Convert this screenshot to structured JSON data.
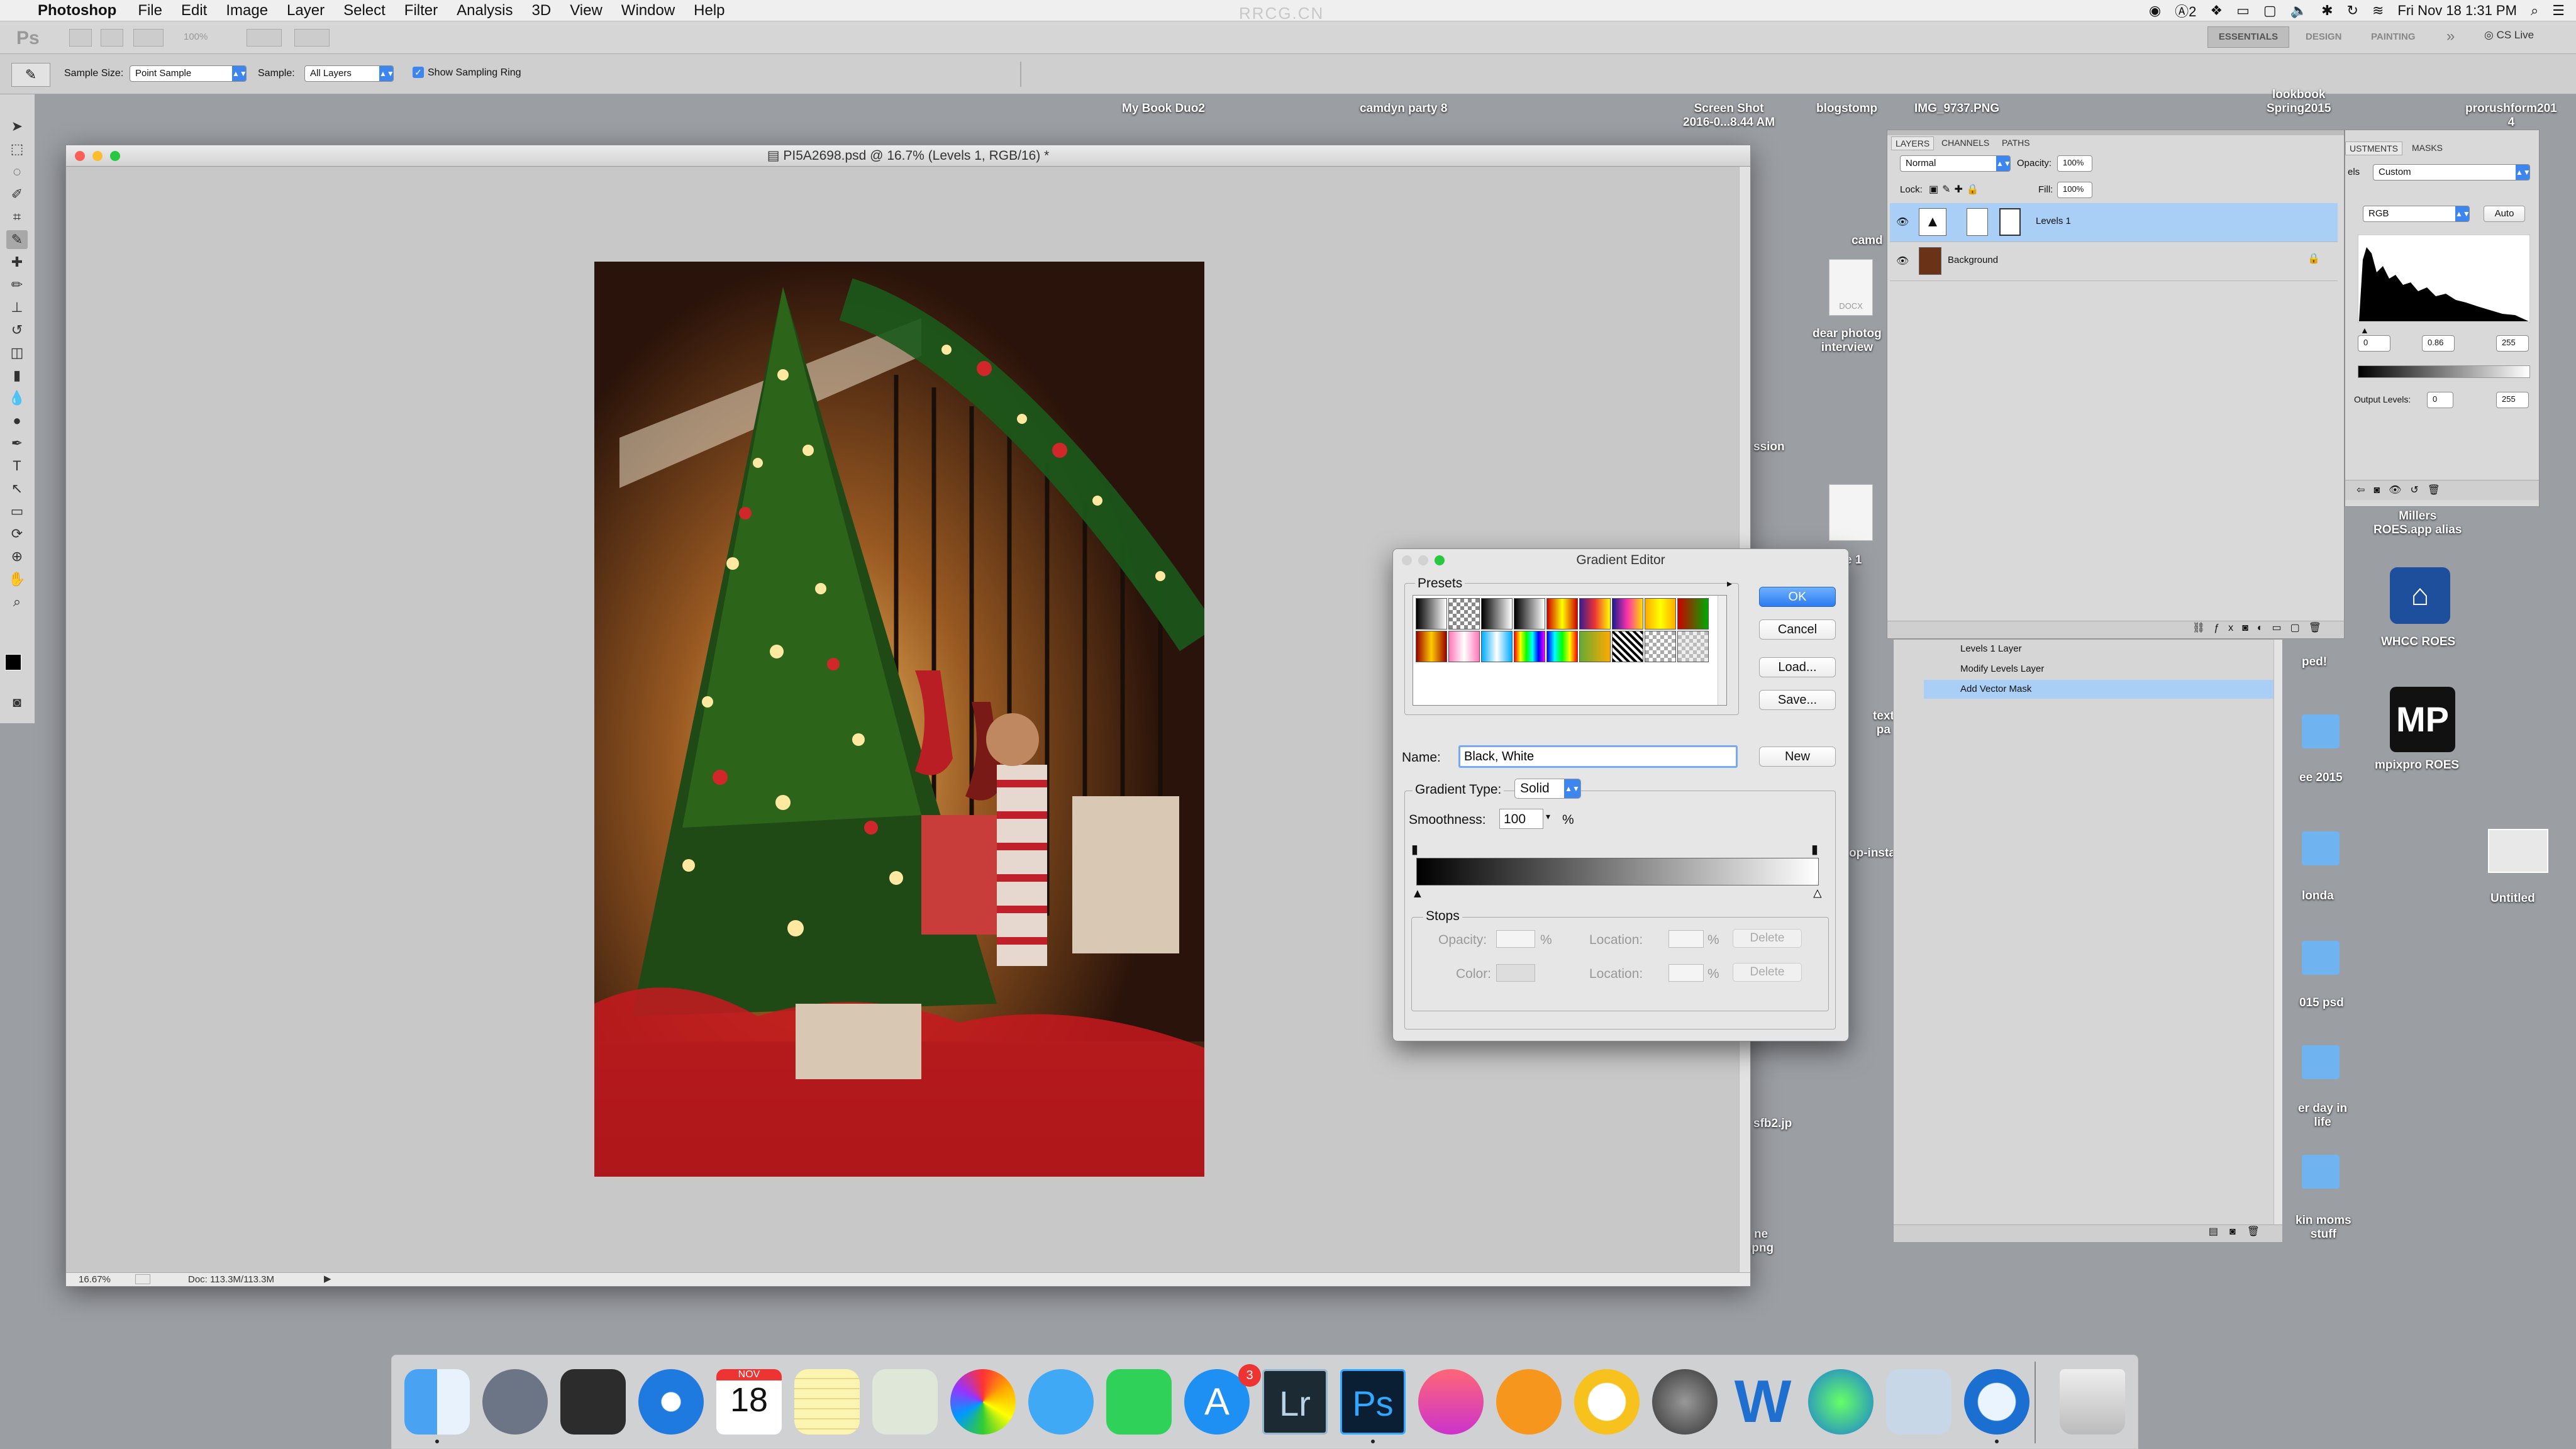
{
  "menubar": {
    "app_name": "Photoshop",
    "menus": [
      "File",
      "Edit",
      "Image",
      "Layer",
      "Select",
      "Filter",
      "Analysis",
      "3D",
      "View",
      "Window",
      "Help"
    ],
    "watermark": "RRCG.CN",
    "status_2": "2",
    "clock": "Fri Nov 18  1:31 PM"
  },
  "appbar": {
    "workspaces": [
      "ESSENTIALS",
      "DESIGN",
      "PAINTING"
    ],
    "more": "»",
    "cs_live": "CS Live",
    "zoom": "100%"
  },
  "options": {
    "sample_size_label": "Sample Size:",
    "sample_size_value": "Point Sample",
    "sample_label": "Sample:",
    "sample_value": "All Layers",
    "ring_label": "Show Sampling Ring"
  },
  "desktop": {
    "labels": {
      "mybook": "My Book Duo2",
      "camdyn": "camdyn party 8",
      "screenshot": "Screen Shot\n2016-0...8.44 AM",
      "blogstomp": "blogstomp",
      "img": "IMG_9737.PNG",
      "lookbook": "lookbook\nSpring2015",
      "proru": "prorushform201\n4",
      "camd": "camd",
      "dear": "dear photog\ninterview",
      "ssion": "ssion",
      "e1": "e 1",
      "millers": "Millers\nROES.app alias",
      "whcc": "WHCC ROES",
      "mpix": "mpixpro ROES",
      "untitled": "Untitled",
      "ped": "ped!",
      "text": "text\npa",
      "ee2015": "ee 2015",
      "opinsta": "op-insta",
      "londa": "londa",
      "psd15": "015 psd",
      "eday": "er day in\nlife",
      "sfb2": "sfb2.jp",
      "moms": "kin moms\nstuff",
      "ne": "ne\n.png",
      "docx": "DOCX"
    }
  },
  "document": {
    "title": "PI5A2698.psd @ 16.7% (Levels 1, RGB/16) *",
    "zoom": "16.67%",
    "doc_size": "Doc: 113.3M/113.3M"
  },
  "layers_panel": {
    "tabs": [
      "LAYERS",
      "CHANNELS",
      "PATHS"
    ],
    "blend_mode": "Normal",
    "opacity_label": "Opacity:",
    "opacity_value": "100%",
    "lock_label": "Lock:",
    "fill_label": "Fill:",
    "fill_value": "100%",
    "layers": [
      {
        "name": "Levels 1",
        "selected": true
      },
      {
        "name": "Background",
        "selected": false
      }
    ]
  },
  "history_panel": {
    "items": [
      {
        "label": "Levels 1 Layer",
        "selected": false
      },
      {
        "label": "Modify Levels Layer",
        "selected": false
      },
      {
        "label": "Add Vector Mask",
        "selected": true
      }
    ]
  },
  "adjustments_panel": {
    "tabs": [
      "USTMENTS",
      "MASKS"
    ],
    "tab_prefix": "els",
    "preset": "Custom",
    "channel": "RGB",
    "auto_label": "Auto",
    "input_values": [
      "0",
      "0.86",
      "255"
    ],
    "output_label": "Output Levels:",
    "output_values": [
      "0",
      "255"
    ]
  },
  "gradient_editor": {
    "title": "Gradient Editor",
    "presets_label": "Presets",
    "ok_label": "OK",
    "cancel_label": "Cancel",
    "load_label": "Load...",
    "save_label": "Save...",
    "name_label": "Name:",
    "name_value": "Black, White",
    "new_label": "New",
    "gradient_type_label": "Gradient Type:",
    "gradient_type_value": "Solid",
    "smoothness_label": "Smoothness:",
    "smoothness_value": "100",
    "percent": "%",
    "stops_label": "Stops",
    "opacity_label": "Opacity:",
    "color_label": "Color:",
    "location_label": "Location:",
    "delete_label": "Delete",
    "presets": [
      "linear-gradient(90deg,#000,#fff)",
      "repeating-conic-gradient(#888 0 25%,#fff 0 50%) 0 0/12px 12px",
      "linear-gradient(90deg,#000,#fff)",
      "linear-gradient(90deg,#000,#fff)",
      "linear-gradient(90deg,#c00,#ff0,#c00)",
      "linear-gradient(90deg,#3b1a8f,#e33,#ff0)",
      "linear-gradient(90deg,#1a1a8f,#f3a,#fd0)",
      "linear-gradient(90deg,#fa0,#ff0,#fa0)",
      "linear-gradient(90deg,#c00,#0a0)",
      "linear-gradient(90deg,#900,#fc0,#900)",
      "linear-gradient(90deg,#f7b,#fff,#f7b)",
      "linear-gradient(90deg,#0af,#fff,#0af)",
      "linear-gradient(90deg,#f00,#ff0,#0f0,#0ff,#00f,#f0f)",
      "linear-gradient(90deg,#00f,#0ff,#0f0,#ff0,#f00)",
      "linear-gradient(90deg,#6a3,#fa0)",
      "repeating-linear-gradient(45deg,#000 0 4px,#fff 4px 8px)",
      "repeating-conic-gradient(#aaa 0 25%,#fff 0 50%) 0 0/12px 12px",
      "repeating-conic-gradient(#bbb 0 25%,#eee 0 50%) 0 0/12px 12px"
    ]
  },
  "dock": {
    "calendar_month": "NOV",
    "calendar_day": "18",
    "appstore_badge": "3",
    "lr_label": "Lr",
    "ps_label": "Ps"
  },
  "colors": {
    "accent_blue": "#3d86f0",
    "selection_blue": "#a9cff7",
    "desktop_gray": "#9b9ea3"
  }
}
